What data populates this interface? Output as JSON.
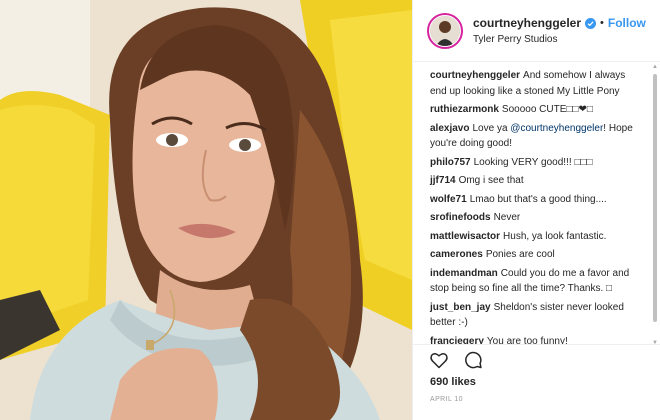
{
  "photo": {
    "alt": ""
  },
  "header": {
    "username": "courtneyhenggeler",
    "verified_icon": "verified-badge-icon",
    "separator": "•",
    "follow_label": "Follow",
    "location": "Tyler Perry Studios"
  },
  "comments": [
    {
      "user": "courtneyhenggeler",
      "text": "And somehow I always end up looking like a stoned My Little Pony"
    },
    {
      "user": "ruthiezarmonk",
      "text": "Sooooo CUTE□□❤□"
    },
    {
      "user": "alexjavo",
      "text": "Love ya ",
      "mention": "@courtneyhenggeler",
      "text_after": "! Hope you're doing good!"
    },
    {
      "user": "philo757",
      "text": "Looking VERY good!!! □□□"
    },
    {
      "user": "jjf714",
      "text": "Omg i see that"
    },
    {
      "user": "wolfe71",
      "text": "Lmao but that's a good thing...."
    },
    {
      "user": "srofinefoods",
      "text": "Never"
    },
    {
      "user": "mattlewisactor",
      "text": "Hush, ya look fantastic."
    },
    {
      "user": "camerones",
      "text": "Ponies are cool"
    },
    {
      "user": "indemandman",
      "text": "Could you do me a favor and stop being so fine all the time? Thanks. □"
    },
    {
      "user": "just_ben_jay",
      "text": "Sheldon's sister never looked better :-)"
    },
    {
      "user": "franciegery",
      "text": "You are too funny!"
    }
  ],
  "scrollbar": {
    "up": "▲",
    "down": "▼"
  },
  "actions": {
    "like_icon": "heart-icon",
    "comment_icon": "comment-icon"
  },
  "likes": "690 likes",
  "date": "APRIL 10",
  "colors": {
    "link": "#3897f0",
    "mention": "#003569",
    "chair": "#f2d330",
    "ring": "#d6249f"
  }
}
